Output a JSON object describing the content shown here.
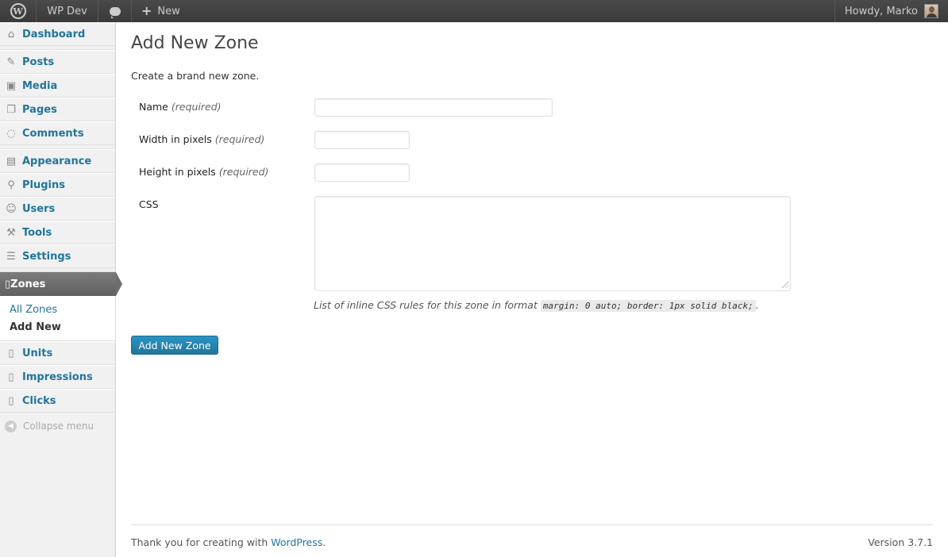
{
  "adminbar": {
    "site_name": "WP Dev",
    "new_label": "New",
    "howdy": "Howdy, Marko"
  },
  "sidebar": {
    "items_top": [
      {
        "label": "Dashboard",
        "icon": "dashboard-icon"
      }
    ],
    "items_content": [
      {
        "label": "Posts",
        "icon": "pin-icon"
      },
      {
        "label": "Media",
        "icon": "media-icon"
      },
      {
        "label": "Pages",
        "icon": "pages-icon"
      },
      {
        "label": "Comments",
        "icon": "comment-icon"
      }
    ],
    "items_admin": [
      {
        "label": "Appearance",
        "icon": "appearance-icon"
      },
      {
        "label": "Plugins",
        "icon": "plugin-icon"
      },
      {
        "label": "Users",
        "icon": "users-icon"
      },
      {
        "label": "Tools",
        "icon": "tools-icon"
      },
      {
        "label": "Settings",
        "icon": "settings-icon"
      }
    ],
    "zones": {
      "label": "Zones",
      "submenu": [
        "All Zones",
        "Add New"
      ]
    },
    "items_bottom": [
      {
        "label": "Units",
        "icon": "document-icon"
      },
      {
        "label": "Impressions",
        "icon": "document-icon"
      },
      {
        "label": "Clicks",
        "icon": "document-icon"
      }
    ],
    "collapse_label": "Collapse menu"
  },
  "main": {
    "title": "Add New Zone",
    "intro": "Create a brand new zone.",
    "required": "(required)",
    "fields": {
      "name_label": "Name",
      "width_label": "Width in pixels",
      "height_label": "Height in pixels",
      "css_label": "CSS"
    },
    "help_text": "List of inline CSS rules for this zone in format",
    "help_code": "margin: 0 auto; border: 1px solid black;",
    "help_end": ".",
    "submit_label": "Add New Zone"
  },
  "footer": {
    "thanks_prefix": "Thank you for creating with ",
    "thanks_link": "WordPress",
    "thanks_suffix": ".",
    "version": "Version 3.7.1"
  }
}
